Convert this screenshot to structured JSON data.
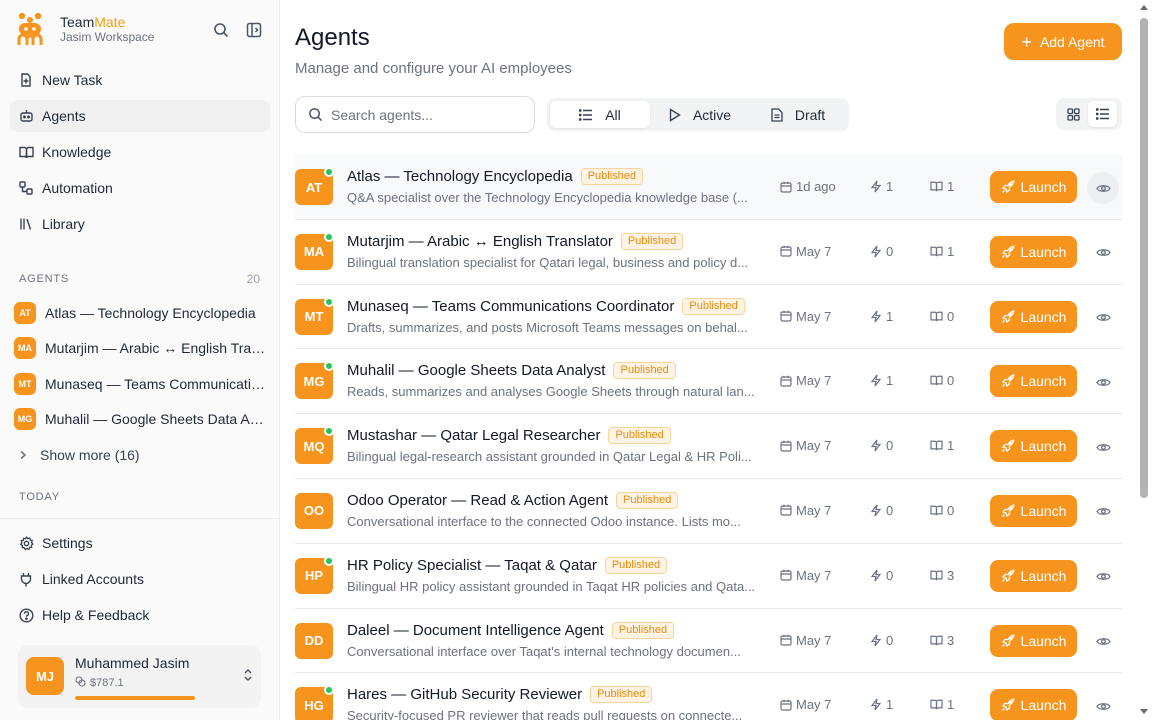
{
  "brand": {
    "name_main": "Team",
    "name_accent": "Mate",
    "workspace": "Jasim Workspace"
  },
  "nav": [
    {
      "label": "New Task",
      "icon": "new-task-icon"
    },
    {
      "label": "Agents",
      "icon": "agents-icon",
      "active": true
    },
    {
      "label": "Knowledge",
      "icon": "book-icon"
    },
    {
      "label": "Automation",
      "icon": "automation-icon"
    },
    {
      "label": "Library",
      "icon": "library-icon"
    }
  ],
  "sidebar_agents": {
    "label": "AGENTS",
    "count": "20",
    "items": [
      {
        "initials": "AT",
        "name": "Atlas — Technology Encyclopedia"
      },
      {
        "initials": "MA",
        "name": "Mutarjim — Arabic ↔ English Translator"
      },
      {
        "initials": "MT",
        "name": "Munaseq — Teams Communications Coordinator"
      },
      {
        "initials": "MG",
        "name": "Muhalil — Google Sheets Data Analyst"
      }
    ],
    "show_more": "Show more (16)"
  },
  "today_label": "TODAY",
  "bottom_nav": [
    {
      "label": "Settings",
      "icon": "gear-icon"
    },
    {
      "label": "Linked Accounts",
      "icon": "plug-icon"
    },
    {
      "label": "Help & Feedback",
      "icon": "help-icon"
    }
  ],
  "user": {
    "initials": "MJ",
    "name": "Muhammed Jasim",
    "credit": "$787.1",
    "credit_fraction": 0.79
  },
  "main": {
    "title": "Agents",
    "subtitle": "Manage and configure your AI employees",
    "add_label": "Add Agent",
    "search_placeholder": "Search agents...",
    "filters": [
      {
        "label": "All",
        "icon": "list-icon",
        "active": true
      },
      {
        "label": "Active",
        "icon": "play-icon"
      },
      {
        "label": "Draft",
        "icon": "document-icon"
      }
    ]
  },
  "launch_label": "Launch",
  "agents": [
    {
      "initials": "AT",
      "name": "Atlas — Technology Encyclopedia",
      "status": "Published",
      "desc": "Q&A specialist over the Technology Encyclopedia knowledge base (...",
      "date": "1d ago",
      "runs": "1",
      "docs": "1",
      "online": true
    },
    {
      "initials": "MA",
      "name": "Mutarjim — Arabic ↔ English Translator",
      "status": "Published",
      "desc": "Bilingual translation specialist for Qatari legal, business and policy d...",
      "date": "May 7",
      "runs": "0",
      "docs": "1",
      "online": true
    },
    {
      "initials": "MT",
      "name": "Munaseq — Teams Communications Coordinator",
      "status": "Published",
      "desc": "Drafts, summarizes, and posts Microsoft Teams messages on behal...",
      "date": "May 7",
      "runs": "1",
      "docs": "0",
      "online": true
    },
    {
      "initials": "MG",
      "name": "Muhalil — Google Sheets Data Analyst",
      "status": "Published",
      "desc": "Reads, summarizes and analyses Google Sheets through natural lan...",
      "date": "May 7",
      "runs": "1",
      "docs": "0",
      "online": true
    },
    {
      "initials": "MQ",
      "name": "Mustashar — Qatar Legal Researcher",
      "status": "Published",
      "desc": "Bilingual legal-research assistant grounded in Qatar Legal & HR Poli...",
      "date": "May 7",
      "runs": "0",
      "docs": "1",
      "online": true
    },
    {
      "initials": "OO",
      "name": "Odoo Operator — Read & Action Agent",
      "status": "Published",
      "desc": "Conversational interface to the connected Odoo instance. Lists mo...",
      "date": "May 7",
      "runs": "0",
      "docs": "0",
      "online": false
    },
    {
      "initials": "HP",
      "name": "HR Policy Specialist — Taqat & Qatar",
      "status": "Published",
      "desc": "Bilingual HR policy assistant grounded in Taqat HR policies and Qata...",
      "date": "May 7",
      "runs": "0",
      "docs": "3",
      "online": true
    },
    {
      "initials": "DD",
      "name": "Daleel — Document Intelligence Agent",
      "status": "Published",
      "desc": "Conversational interface over Taqat's internal technology documen...",
      "date": "May 7",
      "runs": "0",
      "docs": "3",
      "online": false
    },
    {
      "initials": "HG",
      "name": "Hares — GitHub Security Reviewer",
      "status": "Published",
      "desc": "Security-focused PR reviewer that reads pull requests on connecte...",
      "date": "May 7",
      "runs": "1",
      "docs": "1",
      "online": true
    }
  ],
  "colors": {
    "accent": "#f7941d",
    "online": "#22c55e",
    "badge_text": "#ea8a10"
  }
}
